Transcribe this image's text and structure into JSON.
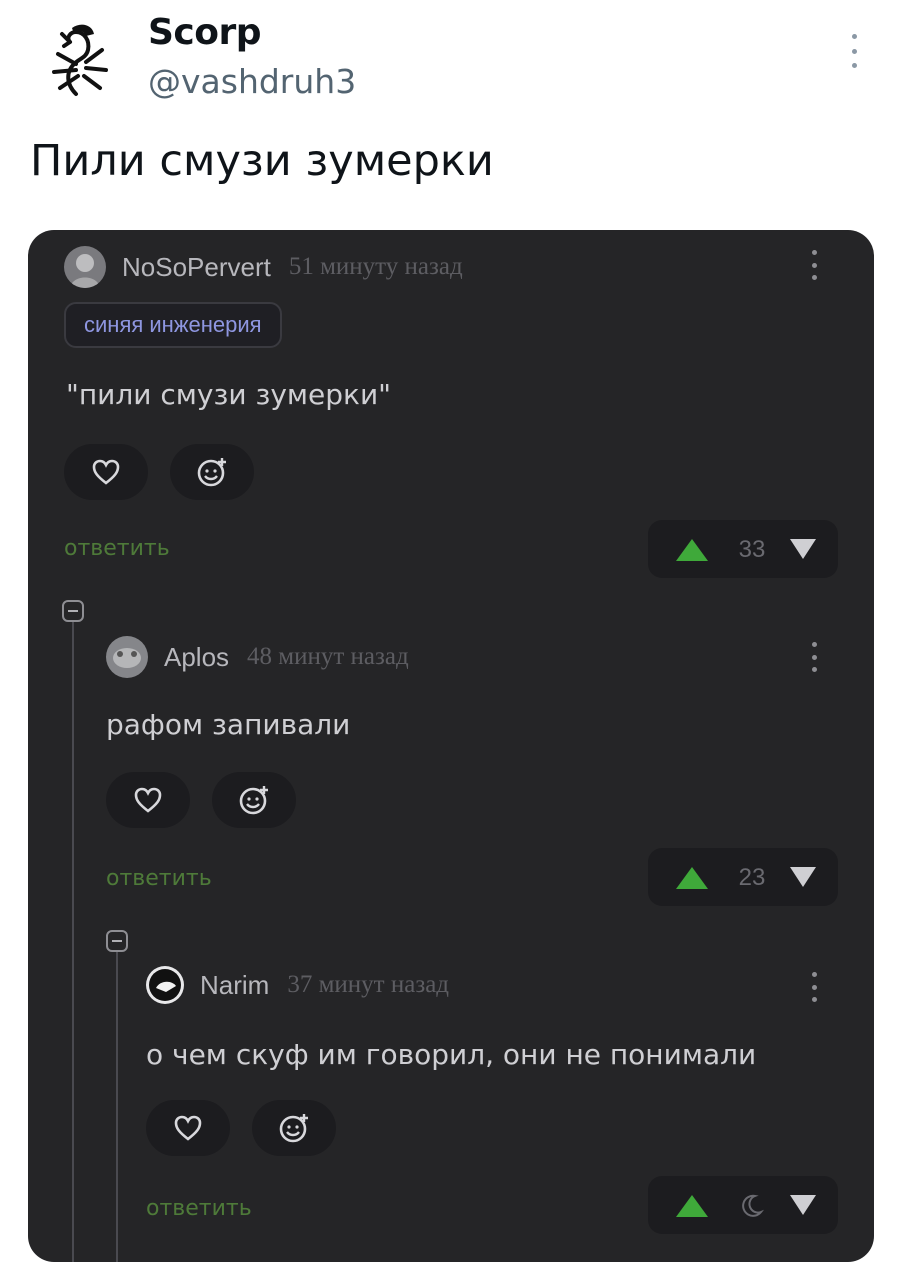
{
  "tweet": {
    "author_name": "Scorp",
    "author_handle": "@vashdruh3",
    "text": "Пили смузи зумерки"
  },
  "embed": {
    "comments": [
      {
        "username": "NoSoPervert",
        "time": "51 минуту назад",
        "tag": "синяя инженерия",
        "text": "\"пили смузи зумерки\"",
        "reply_label": "ответить",
        "rating": "33"
      },
      {
        "username": "Aplos",
        "time": "48 минут назад",
        "text": "рафом запивали",
        "reply_label": "ответить",
        "rating": "23"
      },
      {
        "username": "Narim",
        "time": "37 минут назад",
        "text": "о чем скуф им говорил, они не понимали",
        "reply_label": "ответить",
        "rating_icon": "moon-clock-icon"
      }
    ]
  },
  "colors": {
    "card_bg": "#252527",
    "upvote": "#3fa93a",
    "reply": "#4e7a39",
    "tag_text": "#8e96e0"
  }
}
